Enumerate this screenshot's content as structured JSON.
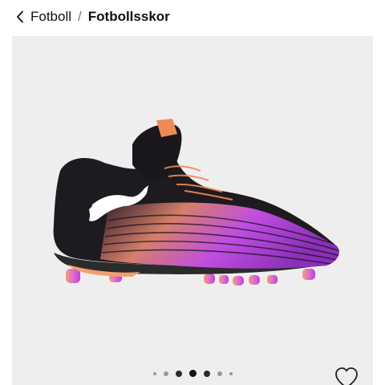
{
  "breadcrumb": {
    "back_icon": "chevron-left-icon",
    "parent": "Fotboll",
    "separator": "/",
    "current": "Fotbollsskor"
  },
  "gallery": {
    "image_subject": "Black and purple Puma football boot with orange accents",
    "colors": {
      "background": "#efeeef",
      "boot_primary": "#1b1b1f",
      "boot_purple": "#b455e0",
      "boot_orange": "#f08a55"
    },
    "dot_count": 7,
    "active_dot": 4
  },
  "wishlist": {
    "icon": "heart-outline-icon"
  }
}
